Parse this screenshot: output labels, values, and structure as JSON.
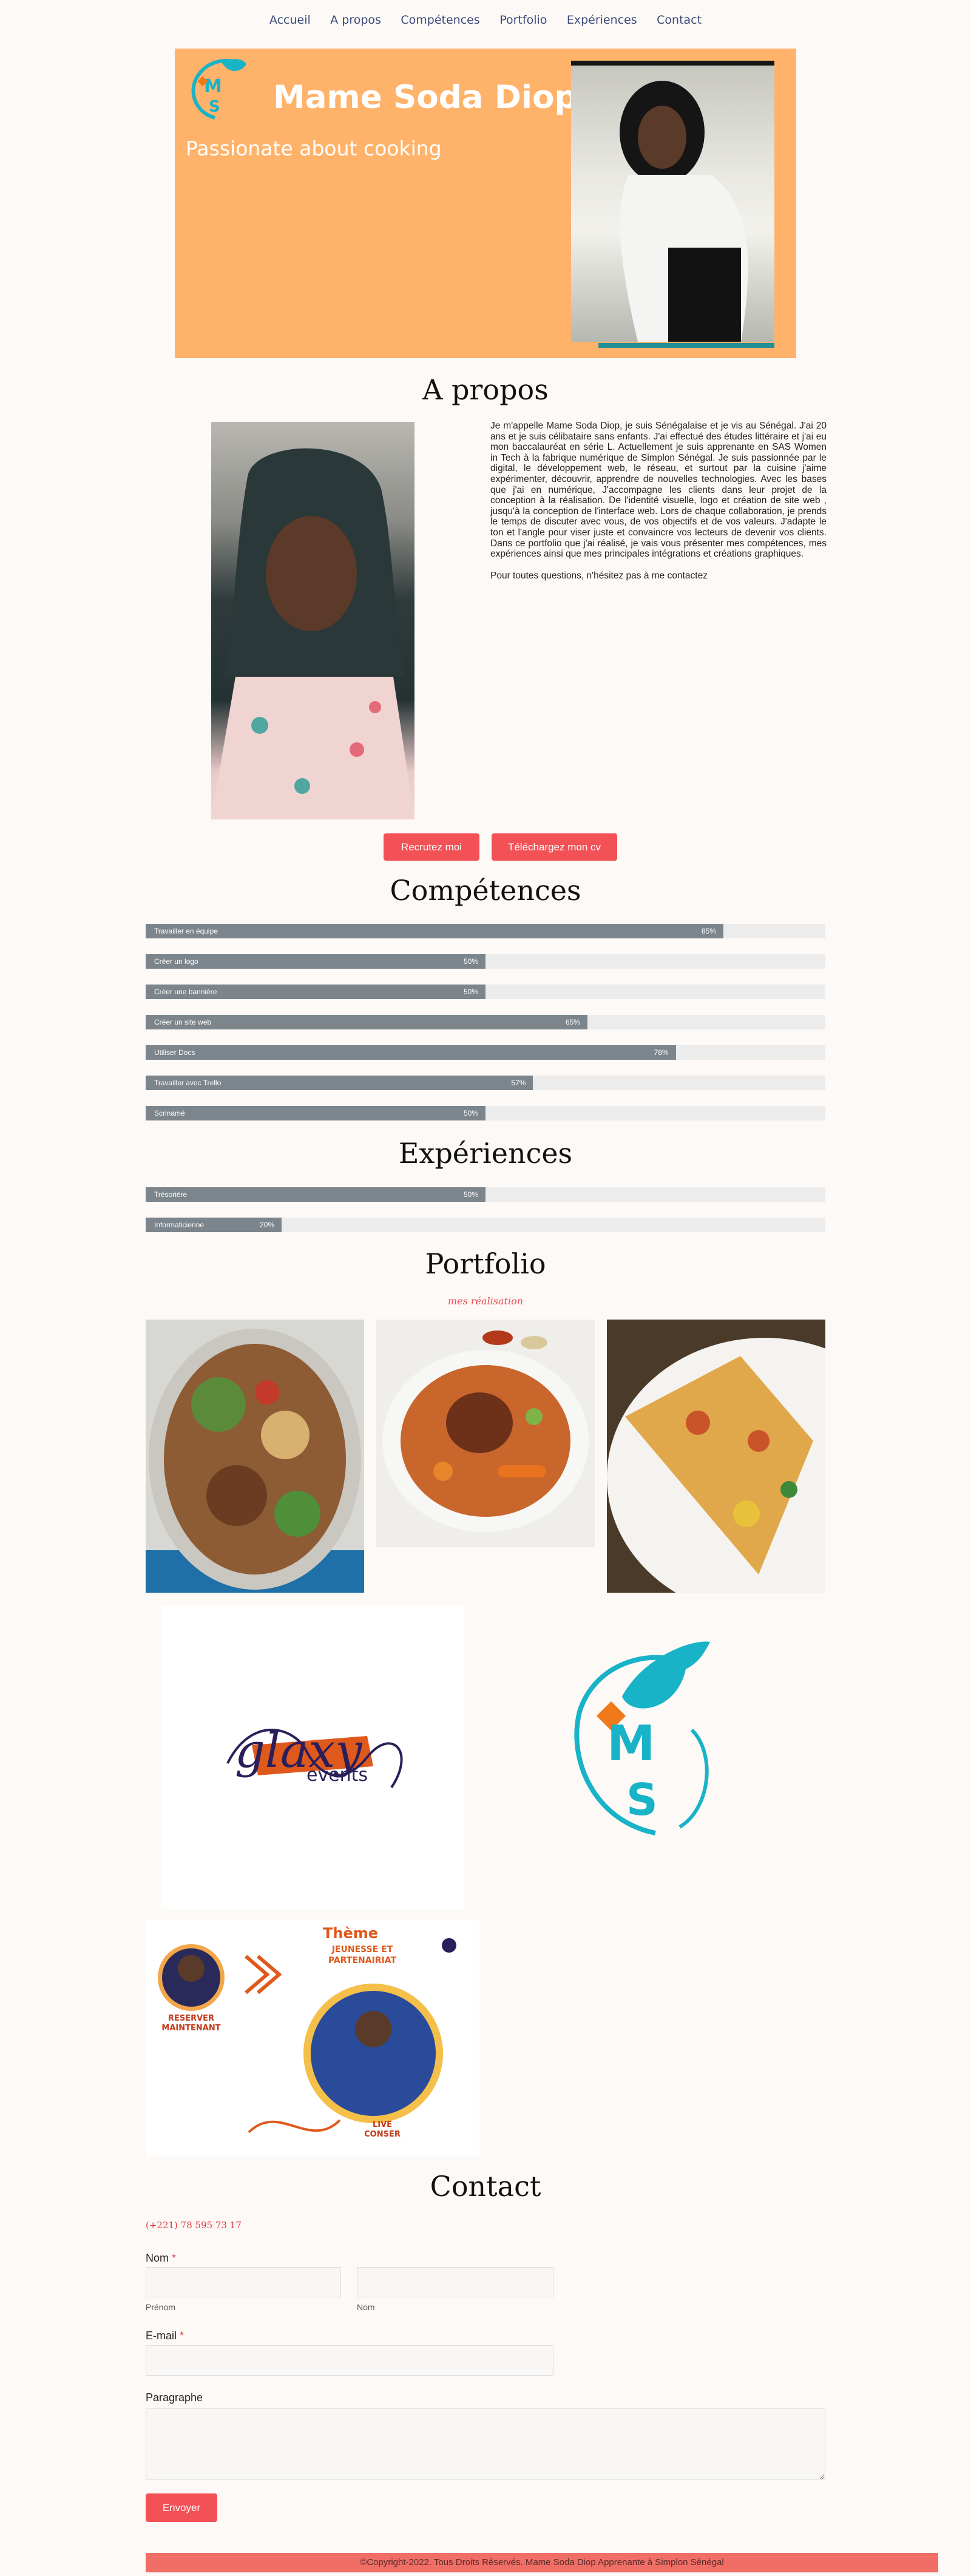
{
  "nav": [
    "Accueil",
    "A propos",
    "Compétences",
    "Portfolio",
    "Expériences",
    "Contact"
  ],
  "hero": {
    "name": "Mame Soda Diop",
    "tagline": "Passionate about cooking"
  },
  "about": {
    "title": "A propos",
    "paragraph1": "Je m'appelle Mame Soda Diop, je suis Sénégalaise et je vis au Sénégal. J'ai 20 ans et je suis célibataire sans enfants. J'ai effectué des études littéraire et j'ai eu mon baccalauréat en série L. Actuellement je suis apprenante en SAS Women in Tech à la fabrique numérique de Simplon Sénégal. Je suis passionnée par le digital, le développement web, le réseau, et surtout par la cuisine j'aime expérimenter, découvrir, apprendre de nouvelles technologies. Avec les bases que j'ai en numérique, J'accompagne les clients dans leur projet de la conception à la réalisation. De l'identité visuelle, logo et création de site web , jusqu'à la conception de l'interface web. Lors de chaque collaboration, je prends le temps de discuter avec vous, de vos objectifs et de vos valeurs. J'adapte le ton et l'angle pour viser juste et convaincre vos lecteurs de devenir vos clients. Dans ce portfolio que j'ai réalisé, je vais vous présenter mes compétences, mes expériences ainsi que mes principales intégrations et créations graphiques.",
    "paragraph2": "Pour toutes questions, n'hésitez pas à me contactez",
    "btn_hire": "Recrutez moi",
    "btn_cv": "Téléchargez mon cv"
  },
  "skills": {
    "title": "Compétences",
    "items": [
      {
        "label": "Travailler en équipe",
        "percent": 85,
        "text": "85%"
      },
      {
        "label": "Créer un logo",
        "percent": 50,
        "text": "50%"
      },
      {
        "label": "Créer une bannière",
        "percent": 50,
        "text": "50%"
      },
      {
        "label": "Créer un site web",
        "percent": 65,
        "text": "65%"
      },
      {
        "label": "Utiliser Docs",
        "percent": 78,
        "text": "78%"
      },
      {
        "label": "Travailler avec Trello",
        "percent": 57,
        "text": "57%"
      },
      {
        "label": "Scrinamé",
        "percent": 50,
        "text": "50%"
      }
    ]
  },
  "experiences": {
    "title": "Expériences",
    "items": [
      {
        "label": "Trésorière",
        "percent": 50,
        "text": "50%"
      },
      {
        "label": "Informaticienne",
        "percent": 20,
        "text": "20%"
      }
    ]
  },
  "portfolio": {
    "title": "Portfolio",
    "subtitle": "mes réalisation",
    "galaxy_word": "glaxy",
    "galaxy_sub": "events",
    "flyer": {
      "theme": "Thème",
      "theme_sub": "JEUNESSE ET PARTENAIRIAT",
      "reserve": "RESERVER MAINTENANT",
      "live": "LIVE CONSER"
    }
  },
  "contact": {
    "title": "Contact",
    "phone": "(+221) 78 595 73 17",
    "name_label": "Nom",
    "required": "*",
    "first_sub": "Prénom",
    "last_sub": "Nom",
    "email_label": "E-mail",
    "paragraph_label": "Paragraphe",
    "send": "Envoyer"
  },
  "footer": "©Copyright-2022. Tous Droits Réservés. Mame Soda Diop Apprenante à Simplon Sénégal",
  "colors": {
    "accent": "#f25156",
    "hero": "#ffb36a",
    "teal": "#19b3c8",
    "bar": "#7c858c"
  }
}
